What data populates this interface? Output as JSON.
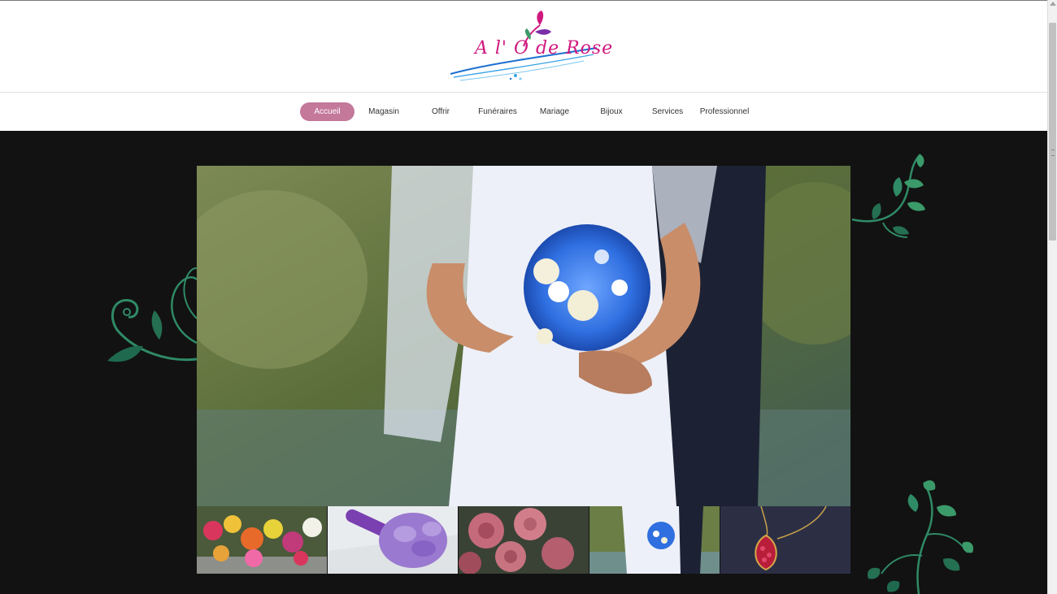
{
  "site": {
    "logo_text": "A l' O de Rose"
  },
  "nav": {
    "items": [
      {
        "label": "Accueil",
        "active": true
      },
      {
        "label": "Magasin"
      },
      {
        "label": "Offrir"
      },
      {
        "label": "Funéraires"
      },
      {
        "label": "Mariage"
      },
      {
        "label": "Bijoux"
      },
      {
        "label": "Services"
      },
      {
        "label": "Professionnel"
      }
    ]
  },
  "colors": {
    "accent": "#c4789a",
    "logo_pink": "#d0197f",
    "logo_blue": "#1e6fd0",
    "background": "#121212",
    "vine_green": "#3b9a6a"
  },
  "slider": {
    "main_image": "wedding-bouquet-photo",
    "thumbnails": [
      "flower-market-photo",
      "purple-calla-bouquet-photo",
      "pink-roses-photo",
      "wedding-bouquet-thumb-photo",
      "ruby-pendant-photo"
    ]
  }
}
